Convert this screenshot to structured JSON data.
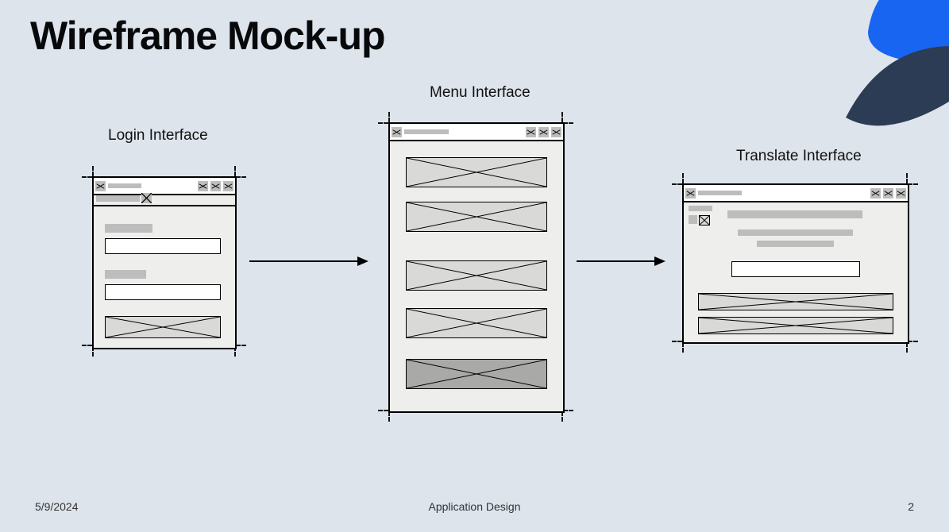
{
  "title": "Wireframe Mock-up",
  "labels": {
    "login": "Login Interface",
    "menu": "Menu Interface",
    "translate": "Translate Interface"
  },
  "footer": {
    "date": "5/9/2024",
    "center": "Application Design",
    "page": "2"
  }
}
